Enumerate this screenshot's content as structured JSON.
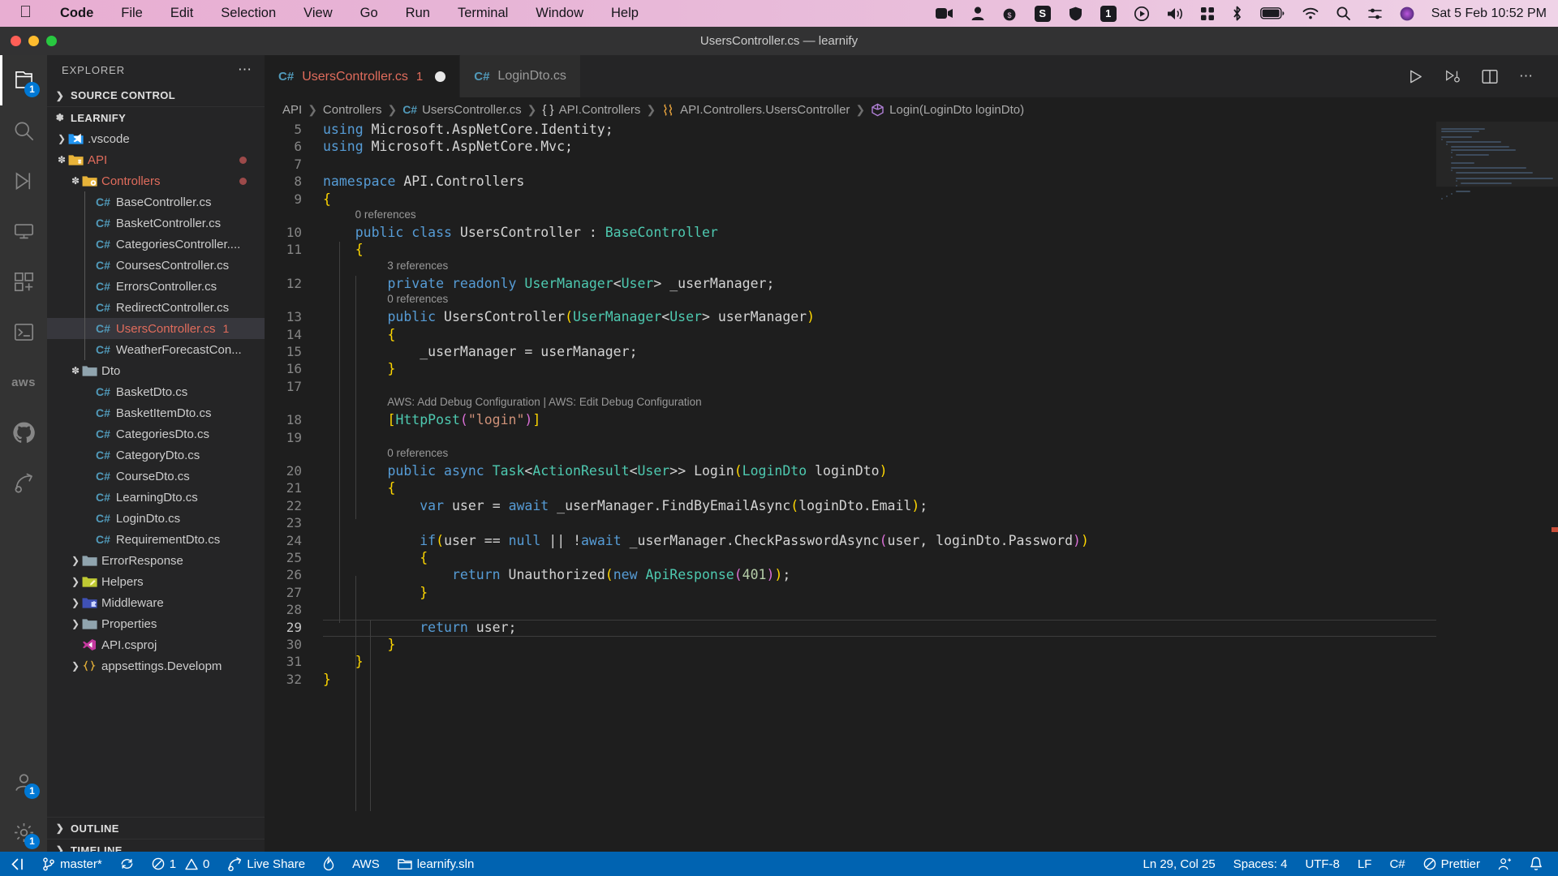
{
  "menubar": {
    "apple_icon": "apple-icon",
    "items": [
      {
        "label": "Code",
        "bold": true
      },
      {
        "label": "File",
        "bold": false
      },
      {
        "label": "Edit",
        "bold": false
      },
      {
        "label": "Selection",
        "bold": false
      },
      {
        "label": "View",
        "bold": false
      },
      {
        "label": "Go",
        "bold": false
      },
      {
        "label": "Run",
        "bold": false
      },
      {
        "label": "Terminal",
        "bold": false
      },
      {
        "label": "Window",
        "bold": false
      },
      {
        "label": "Help",
        "bold": false
      }
    ],
    "status_icons": [
      "video-camera-icon",
      "user-icon",
      "moneybag-icon",
      "s-badge-icon",
      "shield-icon",
      "one-badge-icon",
      "play-circle-icon",
      "volume-icon",
      "grid-icon",
      "bluetooth-icon",
      "battery-icon",
      "wifi-icon",
      "search-icon",
      "control-center-icon",
      "siri-icon"
    ],
    "clock": "Sat 5 Feb  10:52 PM"
  },
  "titlebar": {
    "title": "UsersController.cs — learnify",
    "traffic_colors": [
      "#ff5f57",
      "#febc2e",
      "#28c840"
    ]
  },
  "activitybar": {
    "items": [
      {
        "name": "explorer-icon",
        "badge": "1",
        "active": true
      },
      {
        "name": "search-icon",
        "badge": "",
        "active": false
      },
      {
        "name": "run-and-debug-icon",
        "badge": "",
        "active": false
      },
      {
        "name": "remote-explorer-icon",
        "badge": "",
        "active": false
      },
      {
        "name": "extensions-icon",
        "badge": "",
        "active": false
      },
      {
        "name": "terminal-icon",
        "badge": "",
        "active": false
      },
      {
        "name": "aws-toolkit-icon",
        "badge": "",
        "active": false,
        "text": "aws"
      },
      {
        "name": "github-icon",
        "badge": "",
        "active": false
      },
      {
        "name": "live-share-icon",
        "badge": "",
        "active": false
      }
    ],
    "bottom_items": [
      {
        "name": "accounts-icon",
        "badge": "1"
      },
      {
        "name": "settings-gear-icon",
        "badge": "1"
      }
    ]
  },
  "sidebar": {
    "header_title": "EXPLORER",
    "header_actions_icon": "ellipsis-icon",
    "sections": [
      {
        "label": "SOURCE CONTROL",
        "expanded": false
      },
      {
        "label": "LEARNIFY",
        "expanded": true
      },
      {
        "label": "OUTLINE",
        "expanded": false
      },
      {
        "label": "TIMELINE",
        "expanded": false
      }
    ],
    "tree": [
      {
        "label": ".vscode",
        "depth": 1,
        "type": "folder",
        "icon": "vscode-folder-icon",
        "expanded": false,
        "chevron": true,
        "modified": false,
        "error_dot": false,
        "count": ""
      },
      {
        "label": "API",
        "depth": 1,
        "type": "folder",
        "icon": "api-folder-icon",
        "expanded": true,
        "chevron": true,
        "modified": true,
        "error_dot": true,
        "count": ""
      },
      {
        "label": "Controllers",
        "depth": 2,
        "type": "folder",
        "icon": "controllers-folder-icon",
        "expanded": true,
        "chevron": true,
        "modified": true,
        "error_dot": true,
        "count": ""
      },
      {
        "label": "BaseController.cs",
        "depth": 3,
        "type": "file",
        "icon": "csharp-icon",
        "expanded": false,
        "chevron": false,
        "modified": false,
        "error_dot": false,
        "count": ""
      },
      {
        "label": "BasketController.cs",
        "depth": 3,
        "type": "file",
        "icon": "csharp-icon",
        "expanded": false,
        "chevron": false,
        "modified": false,
        "error_dot": false,
        "count": ""
      },
      {
        "label": "CategoriesController....",
        "depth": 3,
        "type": "file",
        "icon": "csharp-icon",
        "expanded": false,
        "chevron": false,
        "modified": false,
        "error_dot": false,
        "count": ""
      },
      {
        "label": "CoursesController.cs",
        "depth": 3,
        "type": "file",
        "icon": "csharp-icon",
        "expanded": false,
        "chevron": false,
        "modified": false,
        "error_dot": false,
        "count": ""
      },
      {
        "label": "ErrorsController.cs",
        "depth": 3,
        "type": "file",
        "icon": "csharp-icon",
        "expanded": false,
        "chevron": false,
        "modified": false,
        "error_dot": false,
        "count": ""
      },
      {
        "label": "RedirectController.cs",
        "depth": 3,
        "type": "file",
        "icon": "csharp-icon",
        "expanded": false,
        "chevron": false,
        "modified": false,
        "error_dot": false,
        "count": ""
      },
      {
        "label": "UsersController.cs",
        "depth": 3,
        "type": "file",
        "icon": "csharp-icon",
        "expanded": false,
        "chevron": false,
        "modified": true,
        "error_dot": false,
        "count": "1",
        "selected": true
      },
      {
        "label": "WeatherForecastCon...",
        "depth": 3,
        "type": "file",
        "icon": "csharp-icon",
        "expanded": false,
        "chevron": false,
        "modified": false,
        "error_dot": false,
        "count": ""
      },
      {
        "label": "Dto",
        "depth": 2,
        "type": "folder",
        "icon": "plain-folder-icon",
        "expanded": true,
        "chevron": true,
        "modified": false,
        "error_dot": false,
        "count": ""
      },
      {
        "label": "BasketDto.cs",
        "depth": 3,
        "type": "file",
        "icon": "csharp-icon",
        "expanded": false,
        "chevron": false,
        "modified": false,
        "error_dot": false,
        "count": ""
      },
      {
        "label": "BasketItemDto.cs",
        "depth": 3,
        "type": "file",
        "icon": "csharp-icon",
        "expanded": false,
        "chevron": false,
        "modified": false,
        "error_dot": false,
        "count": ""
      },
      {
        "label": "CategoriesDto.cs",
        "depth": 3,
        "type": "file",
        "icon": "csharp-icon",
        "expanded": false,
        "chevron": false,
        "modified": false,
        "error_dot": false,
        "count": ""
      },
      {
        "label": "CategoryDto.cs",
        "depth": 3,
        "type": "file",
        "icon": "csharp-icon",
        "expanded": false,
        "chevron": false,
        "modified": false,
        "error_dot": false,
        "count": ""
      },
      {
        "label": "CourseDto.cs",
        "depth": 3,
        "type": "file",
        "icon": "csharp-icon",
        "expanded": false,
        "chevron": false,
        "modified": false,
        "error_dot": false,
        "count": ""
      },
      {
        "label": "LearningDto.cs",
        "depth": 3,
        "type": "file",
        "icon": "csharp-icon",
        "expanded": false,
        "chevron": false,
        "modified": false,
        "error_dot": false,
        "count": ""
      },
      {
        "label": "LoginDto.cs",
        "depth": 3,
        "type": "file",
        "icon": "csharp-icon",
        "expanded": false,
        "chevron": false,
        "modified": false,
        "error_dot": false,
        "count": ""
      },
      {
        "label": "RequirementDto.cs",
        "depth": 3,
        "type": "file",
        "icon": "csharp-icon",
        "expanded": false,
        "chevron": false,
        "modified": false,
        "error_dot": false,
        "count": ""
      },
      {
        "label": "ErrorResponse",
        "depth": 2,
        "type": "folder",
        "icon": "plain-folder-icon",
        "expanded": false,
        "chevron": true,
        "modified": false,
        "error_dot": false,
        "count": ""
      },
      {
        "label": "Helpers",
        "depth": 2,
        "type": "folder",
        "icon": "helpers-folder-icon",
        "expanded": false,
        "chevron": true,
        "modified": false,
        "error_dot": false,
        "count": ""
      },
      {
        "label": "Middleware",
        "depth": 2,
        "type": "folder",
        "icon": "middleware-folder-icon",
        "expanded": false,
        "chevron": true,
        "modified": false,
        "error_dot": false,
        "count": ""
      },
      {
        "label": "Properties",
        "depth": 2,
        "type": "folder",
        "icon": "plain-folder-icon",
        "expanded": false,
        "chevron": true,
        "modified": false,
        "error_dot": false,
        "count": ""
      },
      {
        "label": "API.csproj",
        "depth": 2,
        "type": "file",
        "icon": "visualstudio-icon",
        "expanded": false,
        "chevron": false,
        "modified": false,
        "error_dot": false,
        "count": ""
      },
      {
        "label": "appsettings.Developm",
        "depth": 2,
        "type": "file",
        "icon": "json-icon",
        "expanded": false,
        "chevron": true,
        "modified": false,
        "error_dot": false,
        "count": ""
      }
    ]
  },
  "editor": {
    "tabs": [
      {
        "label": "UsersController.cs",
        "icon": "csharp-icon",
        "count": "1",
        "dirty": true,
        "active": true
      },
      {
        "label": "LoginDto.cs",
        "icon": "csharp-icon",
        "count": "",
        "dirty": false,
        "active": false
      }
    ],
    "tab_actions": [
      "run-icon",
      "split-debug-icon",
      "split-editor-icon",
      "more-actions-icon"
    ],
    "breadcrumb": [
      {
        "label": "API",
        "icon": ""
      },
      {
        "label": "Controllers",
        "icon": ""
      },
      {
        "label": "UsersController.cs",
        "icon": "csharp-icon"
      },
      {
        "label": "API.Controllers",
        "icon": "namespace-icon"
      },
      {
        "label": "API.Controllers.UsersController",
        "icon": "class-icon"
      },
      {
        "label": "Login(LoginDto loginDto)",
        "icon": "method-icon"
      }
    ],
    "first_visible_line": 5,
    "current_line": 29,
    "codelens": [
      {
        "after_line": 9,
        "text": "0 references"
      },
      {
        "after_line": 11,
        "text": "3 references"
      },
      {
        "after_line": 12,
        "text": "0 references"
      },
      {
        "after_line": 17,
        "text": "AWS: Add Debug Configuration | AWS: Edit Debug Configuration"
      },
      {
        "after_line": 19,
        "text": "0 references"
      }
    ],
    "lines": [
      {
        "n": 5,
        "text": "using Microsoft.AspNetCore.Identity;"
      },
      {
        "n": 6,
        "text": "using Microsoft.AspNetCore.Mvc;"
      },
      {
        "n": 7,
        "text": ""
      },
      {
        "n": 8,
        "text": "namespace API.Controllers"
      },
      {
        "n": 9,
        "text": "{"
      },
      {
        "n": 10,
        "text": "    public class UsersController : BaseController"
      },
      {
        "n": 11,
        "text": "    {"
      },
      {
        "n": 12,
        "text": "        private readonly UserManager<User> _userManager;"
      },
      {
        "n": 13,
        "text": "        public UsersController(UserManager<User> userManager)"
      },
      {
        "n": 14,
        "text": "        {"
      },
      {
        "n": 15,
        "text": "            _userManager = userManager;"
      },
      {
        "n": 16,
        "text": "        }"
      },
      {
        "n": 17,
        "text": ""
      },
      {
        "n": 18,
        "text": "        [HttpPost(\"login\")]"
      },
      {
        "n": 19,
        "text": ""
      },
      {
        "n": 20,
        "text": "        public async Task<ActionResult<User>> Login(LoginDto loginDto)"
      },
      {
        "n": 21,
        "text": "        {"
      },
      {
        "n": 22,
        "text": "            var user = await _userManager.FindByEmailAsync(loginDto.Email);"
      },
      {
        "n": 23,
        "text": ""
      },
      {
        "n": 24,
        "text": "            if(user == null || !await _userManager.CheckPasswordAsync(user, loginDto.Password))"
      },
      {
        "n": 25,
        "text": "            {"
      },
      {
        "n": 26,
        "text": "                return Unauthorized(new ApiResponse(401));"
      },
      {
        "n": 27,
        "text": "            }"
      },
      {
        "n": 28,
        "text": ""
      },
      {
        "n": 29,
        "text": "            return user;"
      },
      {
        "n": 30,
        "text": "        }"
      },
      {
        "n": 31,
        "text": "    }"
      },
      {
        "n": 32,
        "text": "}"
      }
    ]
  },
  "statusbar": {
    "remote_icon": "remote-window-icon",
    "left": [
      {
        "icon": "source-control-icon",
        "label": "master*",
        "name": "branch-status"
      },
      {
        "icon": "sync-icon",
        "label": "",
        "name": "sync-status"
      },
      {
        "icon": "error-warning-icon",
        "label": "1  0",
        "name": "problems-status"
      },
      {
        "icon": "live-share-icon",
        "label": "Live Share",
        "name": "live-share-status"
      },
      {
        "icon": "flame-icon",
        "label": "",
        "name": "flame-status"
      },
      {
        "icon": "",
        "label": "AWS",
        "name": "aws-status"
      },
      {
        "icon": "folder-icon",
        "label": "learnify.sln",
        "name": "solution-status"
      }
    ],
    "right": [
      {
        "icon": "",
        "label": "Ln 29, Col 25",
        "name": "cursor-position-status"
      },
      {
        "icon": "",
        "label": "Spaces: 4",
        "name": "indentation-status"
      },
      {
        "icon": "",
        "label": "UTF-8",
        "name": "encoding-status"
      },
      {
        "icon": "",
        "label": "LF",
        "name": "eol-status"
      },
      {
        "icon": "",
        "label": "C#",
        "name": "language-mode-status"
      },
      {
        "icon": "prettier-icon",
        "label": "Prettier",
        "name": "prettier-status"
      },
      {
        "icon": "feedback-icon",
        "label": "",
        "name": "feedback-status"
      },
      {
        "icon": "bell-icon",
        "label": "",
        "name": "notifications-status"
      }
    ]
  },
  "colors": {
    "accent": "#0063b1",
    "modified_file": "#e06c5c",
    "csharp_icon": "#519aba",
    "editor_bg": "#1e1e1e",
    "sidebar_bg": "#252526",
    "activitybar_bg": "#333333"
  }
}
